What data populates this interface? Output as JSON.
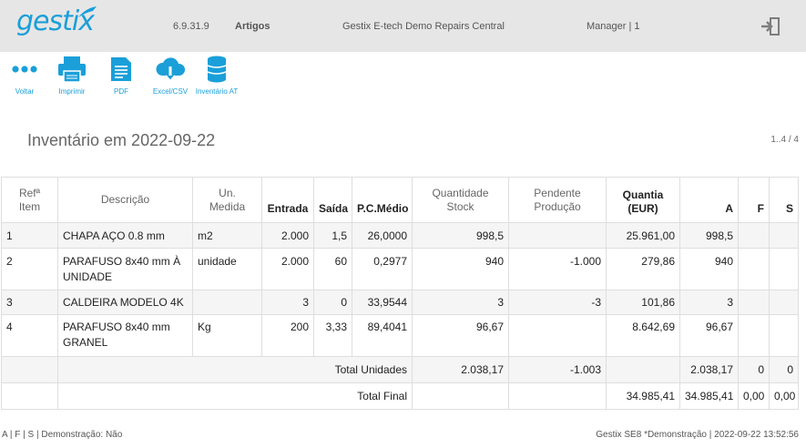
{
  "header": {
    "logo": "gestix",
    "version": "6.9.31.9",
    "module": "Artigos",
    "company": "Gestix E-tech Demo Repairs Central",
    "user": "Manager | 1",
    "logout_icon": "logout-icon"
  },
  "toolbar": {
    "back": "Voltar",
    "print": "Imprimir",
    "pdf": "PDF",
    "excel": "Excel/CSV",
    "inventory_at": "Inventário AT"
  },
  "page": {
    "title": "Inventário em 2022-09-22",
    "pager": "1..4 / 4"
  },
  "table": {
    "headers": {
      "ref_line1": "Refª",
      "ref_line2": "Item",
      "desc": "Descrição",
      "unit_line1": "Un.",
      "unit_line2": "Medida",
      "entrada": "Entrada",
      "saida": "Saída",
      "pcmedio": "P.C.Médio",
      "qty_line1": "Quantidade",
      "qty_line2": "Stock",
      "pend_line1": "Pendente",
      "pend_line2": "Produção",
      "quantia_line1": "Quantia",
      "quantia_line2": "(EUR)",
      "a": "A",
      "f": "F",
      "s": "S"
    },
    "rows": [
      {
        "ref": "1",
        "desc": "CHAPA AÇO 0.8 mm",
        "unit": "m2",
        "entrada": "2.000",
        "saida": "1,5",
        "pcmedio": "26,0000",
        "qty": "998,5",
        "pend": "",
        "quantia": "25.961,00",
        "a": "998,5",
        "f": "",
        "s": ""
      },
      {
        "ref": "2",
        "desc": "PARAFUSO 8x40 mm À UNIDADE",
        "unit": "unidade",
        "entrada": "2.000",
        "saida": "60",
        "pcmedio": "0,2977",
        "qty": "940",
        "pend": "-1.000",
        "quantia": "279,86",
        "a": "940",
        "f": "",
        "s": ""
      },
      {
        "ref": "3",
        "desc": "CALDEIRA MODELO 4K",
        "unit": "",
        "entrada": "3",
        "saida": "0",
        "pcmedio": "33,9544",
        "qty": "3",
        "pend": "-3",
        "quantia": "101,86",
        "a": "3",
        "f": "",
        "s": ""
      },
      {
        "ref": "4",
        "desc": "PARAFUSO 8x40 mm GRANEL",
        "unit": "Kg",
        "entrada": "200",
        "saida": "3,33",
        "pcmedio": "89,4041",
        "qty": "96,67",
        "pend": "",
        "quantia": "8.642,69",
        "a": "96,67",
        "f": "",
        "s": ""
      }
    ],
    "total_units": {
      "label": "Total Unidades",
      "qty": "2.038,17",
      "pend": "-1.003",
      "a": "2.038,17",
      "f": "0",
      "s": "0"
    },
    "total_final": {
      "label": "Total Final",
      "quantia": "34.985,41",
      "a": "34.985,41",
      "f": "0,00",
      "s": "0,00"
    }
  },
  "footer": {
    "left": "A | F | S | Demonstração: Não",
    "right": "Gestix SE8 *Demonstração | 2022-09-22 13:52:56"
  },
  "colors": {
    "accent": "#1a9fd9",
    "topbar": "#e6e6e6"
  }
}
